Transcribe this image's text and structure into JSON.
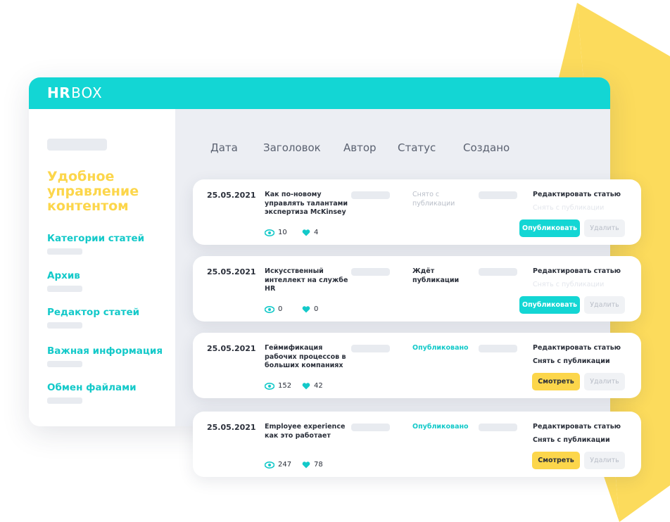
{
  "app": {
    "logo_bold": "HR",
    "logo_light": "BOX"
  },
  "sidebar": {
    "title": "Удобное управление контентом",
    "items": [
      {
        "label": "Категории статей"
      },
      {
        "label": "Архив"
      },
      {
        "label": "Редактор статей"
      },
      {
        "label": "Важная информация"
      },
      {
        "label": "Обмен файлами"
      }
    ]
  },
  "table": {
    "columns": [
      "Дата",
      "Заголовок",
      "Автор",
      "Статус",
      "Создано"
    ],
    "rows": [
      {
        "date": "25.05.2021",
        "title": "Как по-новому управлять талантами экспертиза McKinsey",
        "status": "Снято с публикации",
        "views": "10",
        "likes": "4",
        "edit_label": "Редактировать статью",
        "unpublish_label": "Снять с публикации",
        "action_label": "Опубликовать",
        "delete_label": "Удалить"
      },
      {
        "date": "25.05.2021",
        "title": "Искусственный интеллект на службе HR",
        "status": "Ждёт публикации",
        "views": "0",
        "likes": "0",
        "edit_label": "Редактировать статью",
        "unpublish_label": "Снять с публикации",
        "action_label": "Опубликовать",
        "delete_label": "Удалить"
      },
      {
        "date": "25.05.2021",
        "title": "Геймификация рабочих процессов в больших компаниях",
        "status": "Опубликовано",
        "views": "152",
        "likes": "42",
        "edit_label": "Редактировать статью",
        "unpublish_label": "Снять с публикации",
        "action_label": "Смотреть",
        "delete_label": "Удалить"
      },
      {
        "date": "25.05.2021",
        "title": "Employee experience как это работает",
        "status": "Опубликовано",
        "views": "247",
        "likes": "78",
        "edit_label": "Редактировать статью",
        "unpublish_label": "Снять с публикации",
        "action_label": "Смотреть",
        "delete_label": "Удалить"
      }
    ]
  },
  "colors": {
    "accent": "#13d6d4",
    "highlight": "#fcd64b",
    "background_panel": "#eceef3",
    "text_dark": "#2a2f3a"
  },
  "icons": {
    "views": "eye-icon",
    "likes": "heart-icon"
  }
}
